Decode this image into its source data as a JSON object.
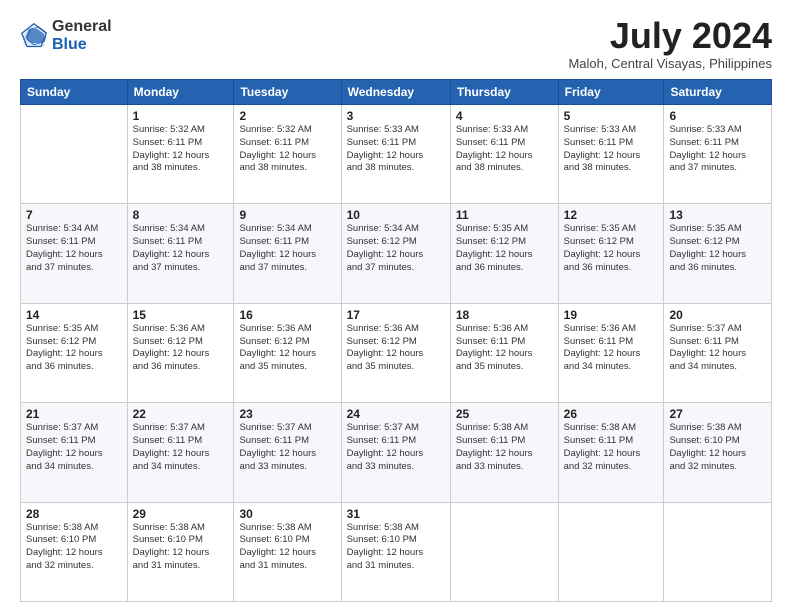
{
  "logo": {
    "general": "General",
    "blue": "Blue"
  },
  "title": "July 2024",
  "location": "Maloh, Central Visayas, Philippines",
  "days_of_week": [
    "Sunday",
    "Monday",
    "Tuesday",
    "Wednesday",
    "Thursday",
    "Friday",
    "Saturday"
  ],
  "weeks": [
    [
      {
        "day": "",
        "info": ""
      },
      {
        "day": "1",
        "info": "Sunrise: 5:32 AM\nSunset: 6:11 PM\nDaylight: 12 hours\nand 38 minutes."
      },
      {
        "day": "2",
        "info": "Sunrise: 5:32 AM\nSunset: 6:11 PM\nDaylight: 12 hours\nand 38 minutes."
      },
      {
        "day": "3",
        "info": "Sunrise: 5:33 AM\nSunset: 6:11 PM\nDaylight: 12 hours\nand 38 minutes."
      },
      {
        "day": "4",
        "info": "Sunrise: 5:33 AM\nSunset: 6:11 PM\nDaylight: 12 hours\nand 38 minutes."
      },
      {
        "day": "5",
        "info": "Sunrise: 5:33 AM\nSunset: 6:11 PM\nDaylight: 12 hours\nand 38 minutes."
      },
      {
        "day": "6",
        "info": "Sunrise: 5:33 AM\nSunset: 6:11 PM\nDaylight: 12 hours\nand 37 minutes."
      }
    ],
    [
      {
        "day": "7",
        "info": "Sunrise: 5:34 AM\nSunset: 6:11 PM\nDaylight: 12 hours\nand 37 minutes."
      },
      {
        "day": "8",
        "info": "Sunrise: 5:34 AM\nSunset: 6:11 PM\nDaylight: 12 hours\nand 37 minutes."
      },
      {
        "day": "9",
        "info": "Sunrise: 5:34 AM\nSunset: 6:11 PM\nDaylight: 12 hours\nand 37 minutes."
      },
      {
        "day": "10",
        "info": "Sunrise: 5:34 AM\nSunset: 6:12 PM\nDaylight: 12 hours\nand 37 minutes."
      },
      {
        "day": "11",
        "info": "Sunrise: 5:35 AM\nSunset: 6:12 PM\nDaylight: 12 hours\nand 36 minutes."
      },
      {
        "day": "12",
        "info": "Sunrise: 5:35 AM\nSunset: 6:12 PM\nDaylight: 12 hours\nand 36 minutes."
      },
      {
        "day": "13",
        "info": "Sunrise: 5:35 AM\nSunset: 6:12 PM\nDaylight: 12 hours\nand 36 minutes."
      }
    ],
    [
      {
        "day": "14",
        "info": "Sunrise: 5:35 AM\nSunset: 6:12 PM\nDaylight: 12 hours\nand 36 minutes."
      },
      {
        "day": "15",
        "info": "Sunrise: 5:36 AM\nSunset: 6:12 PM\nDaylight: 12 hours\nand 36 minutes."
      },
      {
        "day": "16",
        "info": "Sunrise: 5:36 AM\nSunset: 6:12 PM\nDaylight: 12 hours\nand 35 minutes."
      },
      {
        "day": "17",
        "info": "Sunrise: 5:36 AM\nSunset: 6:12 PM\nDaylight: 12 hours\nand 35 minutes."
      },
      {
        "day": "18",
        "info": "Sunrise: 5:36 AM\nSunset: 6:11 PM\nDaylight: 12 hours\nand 35 minutes."
      },
      {
        "day": "19",
        "info": "Sunrise: 5:36 AM\nSunset: 6:11 PM\nDaylight: 12 hours\nand 34 minutes."
      },
      {
        "day": "20",
        "info": "Sunrise: 5:37 AM\nSunset: 6:11 PM\nDaylight: 12 hours\nand 34 minutes."
      }
    ],
    [
      {
        "day": "21",
        "info": "Sunrise: 5:37 AM\nSunset: 6:11 PM\nDaylight: 12 hours\nand 34 minutes."
      },
      {
        "day": "22",
        "info": "Sunrise: 5:37 AM\nSunset: 6:11 PM\nDaylight: 12 hours\nand 34 minutes."
      },
      {
        "day": "23",
        "info": "Sunrise: 5:37 AM\nSunset: 6:11 PM\nDaylight: 12 hours\nand 33 minutes."
      },
      {
        "day": "24",
        "info": "Sunrise: 5:37 AM\nSunset: 6:11 PM\nDaylight: 12 hours\nand 33 minutes."
      },
      {
        "day": "25",
        "info": "Sunrise: 5:38 AM\nSunset: 6:11 PM\nDaylight: 12 hours\nand 33 minutes."
      },
      {
        "day": "26",
        "info": "Sunrise: 5:38 AM\nSunset: 6:11 PM\nDaylight: 12 hours\nand 32 minutes."
      },
      {
        "day": "27",
        "info": "Sunrise: 5:38 AM\nSunset: 6:10 PM\nDaylight: 12 hours\nand 32 minutes."
      }
    ],
    [
      {
        "day": "28",
        "info": "Sunrise: 5:38 AM\nSunset: 6:10 PM\nDaylight: 12 hours\nand 32 minutes."
      },
      {
        "day": "29",
        "info": "Sunrise: 5:38 AM\nSunset: 6:10 PM\nDaylight: 12 hours\nand 31 minutes."
      },
      {
        "day": "30",
        "info": "Sunrise: 5:38 AM\nSunset: 6:10 PM\nDaylight: 12 hours\nand 31 minutes."
      },
      {
        "day": "31",
        "info": "Sunrise: 5:38 AM\nSunset: 6:10 PM\nDaylight: 12 hours\nand 31 minutes."
      },
      {
        "day": "",
        "info": ""
      },
      {
        "day": "",
        "info": ""
      },
      {
        "day": "",
        "info": ""
      }
    ]
  ]
}
